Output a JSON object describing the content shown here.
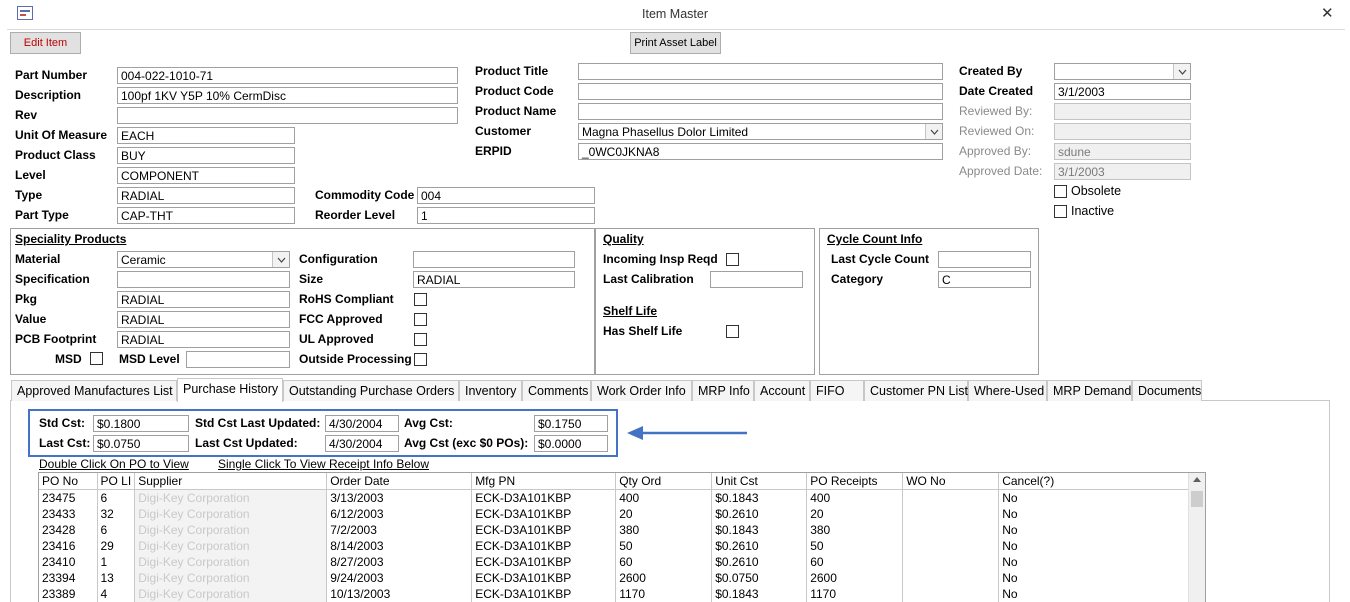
{
  "window": {
    "title": "Item Master",
    "close_glyph": "✕",
    "app_icon": "form-icon"
  },
  "toolbar": {
    "edit_item": "Edit Item",
    "print_label": "Print Asset Label"
  },
  "fields": {
    "part_number": {
      "label": "Part Number",
      "value": "004-022-1010-71"
    },
    "description": {
      "label": "Description",
      "value": "100pf 1KV Y5P 10% CermDisc"
    },
    "rev": {
      "label": "Rev",
      "value": ""
    },
    "uom": {
      "label": "Unit Of Measure",
      "value": "EACH"
    },
    "product_class": {
      "label": "Product Class",
      "value": "BUY"
    },
    "level": {
      "label": "Level",
      "value": "COMPONENT"
    },
    "type": {
      "label": "Type",
      "value": "RADIAL"
    },
    "part_type": {
      "label": "Part Type",
      "value": "CAP-THT"
    },
    "commodity_code": {
      "label": "Commodity Code",
      "value": "004"
    },
    "reorder_level": {
      "label": "Reorder Level",
      "value": "1"
    },
    "product_title": {
      "label": "Product Title",
      "value": ""
    },
    "product_code": {
      "label": "Product Code",
      "value": ""
    },
    "product_name": {
      "label": "Product Name",
      "value": ""
    },
    "customer": {
      "label": "Customer",
      "value": "Magna Phasellus Dolor Limited"
    },
    "erpid": {
      "label": "ERPID",
      "value": "_0WC0JKNA8"
    },
    "created_by": {
      "label": "Created By",
      "value": ""
    },
    "date_created": {
      "label": "Date Created",
      "value": "3/1/2003"
    },
    "reviewed_by": {
      "label": "Reviewed By:",
      "value": ""
    },
    "reviewed_on": {
      "label": "Reviewed On:",
      "value": ""
    },
    "approved_by": {
      "label": "Approved By:",
      "value": "sdune"
    },
    "approved_date": {
      "label": "Approved Date:",
      "value": "3/1/2003"
    },
    "obsolete": {
      "label": "Obsolete",
      "checked": false
    },
    "inactive": {
      "label": "Inactive",
      "checked": false
    }
  },
  "speciality": {
    "heading": "Speciality Products",
    "material": {
      "label": "Material",
      "value": "Ceramic"
    },
    "specification": {
      "label": "Specification",
      "value": ""
    },
    "pkg": {
      "label": "Pkg",
      "value": "RADIAL"
    },
    "value": {
      "label": "Value",
      "value": "RADIAL"
    },
    "pcb_footprint": {
      "label": "PCB Footprint",
      "value": "RADIAL"
    },
    "msd": {
      "label": "MSD"
    },
    "msd_level": {
      "label": "MSD Level",
      "value": ""
    },
    "configuration": {
      "label": "Configuration",
      "value": ""
    },
    "size": {
      "label": "Size",
      "value": "RADIAL"
    },
    "rohs": {
      "label": "RoHS Compliant"
    },
    "fcc": {
      "label": "FCC Approved"
    },
    "ul": {
      "label": "UL Approved"
    },
    "outside": {
      "label": "Outside Processing"
    }
  },
  "quality": {
    "heading": "Quality",
    "incoming": {
      "label": "Incoming Insp Reqd"
    },
    "last_calibration": {
      "label": "Last Calibration",
      "value": ""
    },
    "shelf_life_heading": "Shelf Life",
    "has_shelf_life": {
      "label": "Has Shelf Life"
    }
  },
  "cycle": {
    "heading": "Cycle Count Info",
    "last_cycle_count": {
      "label": "Last Cycle Count",
      "value": ""
    },
    "category": {
      "label": "Category",
      "value": "C"
    }
  },
  "tabs": [
    "Approved Manufactures List",
    "Purchase History",
    "Outstanding Purchase Orders",
    "Inventory",
    "Comments",
    "Work Order Info",
    "MRP Info",
    "Account",
    "FIFO",
    "Customer PN List",
    "Where-Used",
    "MRP Demand",
    "Documents"
  ],
  "cost": {
    "std_cst": {
      "label": "Std Cst:",
      "value": "$0.1800"
    },
    "last_cst": {
      "label": "Last Cst:",
      "value": "$0.0750"
    },
    "std_updated": {
      "label": "Std Cst Last Updated:",
      "value": "4/30/2004"
    },
    "last_updated": {
      "label": "Last Cst Updated:",
      "value": "4/30/2004"
    },
    "avg_cst": {
      "label": "Avg Cst:",
      "value": "$0.1750"
    },
    "avg_exc": {
      "label": "Avg Cst (exc $0 POs):",
      "value": "$0.0000"
    }
  },
  "links": {
    "double_click": "Double Click On PO to View",
    "single_click": "Single Click To View Receipt Info Below"
  },
  "grid": {
    "columns": [
      "PO No",
      "PO LI",
      "Supplier",
      "Order Date",
      "Mfg PN",
      "Qty Ord",
      "Unit Cst",
      "PO Receipts",
      "WO No",
      "Cancel(?)"
    ],
    "rows": [
      [
        "23475",
        "6",
        "Digi-Key Corporation",
        "3/13/2003",
        "ECK-D3A101KBP",
        "400",
        "$0.1843",
        "400",
        "",
        "No"
      ],
      [
        "23433",
        "32",
        "Digi-Key Corporation",
        "6/12/2003",
        "ECK-D3A101KBP",
        "20",
        "$0.2610",
        "20",
        "",
        "No"
      ],
      [
        "23428",
        "6",
        "Digi-Key Corporation",
        "7/2/2003",
        "ECK-D3A101KBP",
        "380",
        "$0.1843",
        "380",
        "",
        "No"
      ],
      [
        "23416",
        "29",
        "Digi-Key Corporation",
        "8/14/2003",
        "ECK-D3A101KBP",
        "50",
        "$0.2610",
        "50",
        "",
        "No"
      ],
      [
        "23410",
        "1",
        "Digi-Key Corporation",
        "8/27/2003",
        "ECK-D3A101KBP",
        "60",
        "$0.2610",
        "60",
        "",
        "No"
      ],
      [
        "23394",
        "13",
        "Digi-Key Corporation",
        "9/24/2003",
        "ECK-D3A101KBP",
        "2600",
        "$0.0750",
        "2600",
        "",
        "No"
      ],
      [
        "23389",
        "4",
        "Digi-Key Corporation",
        "10/13/2003",
        "ECK-D3A101KBP",
        "1170",
        "$0.1843",
        "1170",
        "",
        "No"
      ]
    ]
  },
  "colors": {
    "highlight_box": "#4472c4",
    "arrow": "#4472c4",
    "edit_text": "#c00000"
  }
}
